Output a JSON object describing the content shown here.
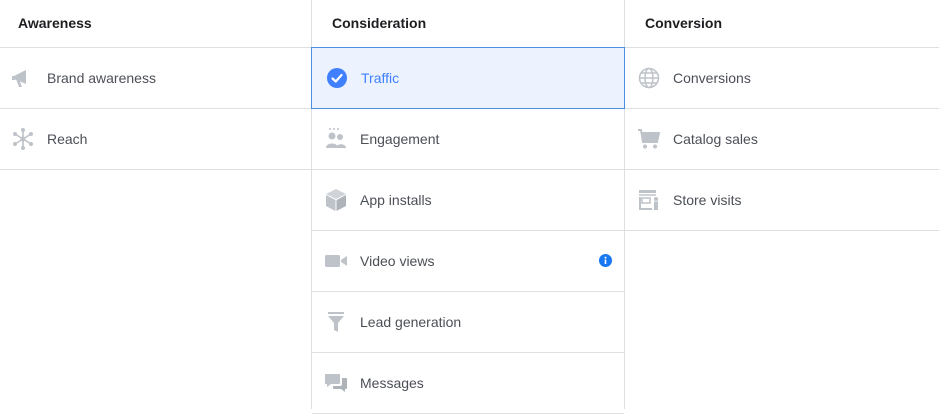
{
  "columns": [
    {
      "header": "Awareness",
      "items": [
        {
          "label": "Brand awareness",
          "icon": "megaphone-icon"
        },
        {
          "label": "Reach",
          "icon": "network-icon"
        }
      ]
    },
    {
      "header": "Consideration",
      "items": [
        {
          "label": "Traffic",
          "icon": "checkmark-circle-icon",
          "selected": true
        },
        {
          "label": "Engagement",
          "icon": "people-icon"
        },
        {
          "label": "App installs",
          "icon": "box-icon"
        },
        {
          "label": "Video views",
          "icon": "video-camera-icon",
          "info": true
        },
        {
          "label": "Lead generation",
          "icon": "funnel-icon"
        },
        {
          "label": "Messages",
          "icon": "chat-bubbles-icon"
        }
      ]
    },
    {
      "header": "Conversion",
      "items": [
        {
          "label": "Conversions",
          "icon": "globe-icon"
        },
        {
          "label": "Catalog sales",
          "icon": "shopping-cart-icon"
        },
        {
          "label": "Store visits",
          "icon": "storefront-icon"
        }
      ]
    }
  ],
  "colors": {
    "border": "#dddfe2",
    "selected_bg": "#ecf3ff",
    "selected_border": "#4a90e2",
    "accent": "#4080ff",
    "icon_gray": "#bec3c9"
  }
}
